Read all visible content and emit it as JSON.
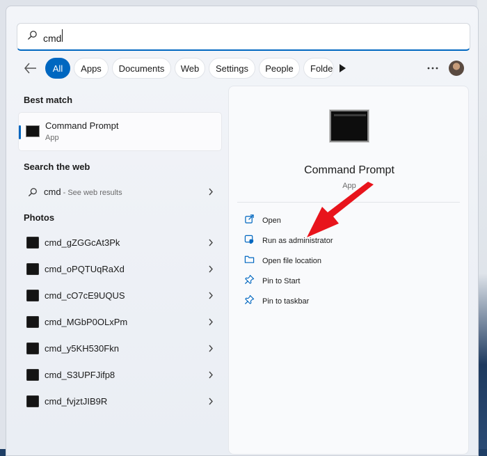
{
  "search": {
    "query": "cmd"
  },
  "filters": [
    {
      "label": "All",
      "active": true
    },
    {
      "label": "Apps"
    },
    {
      "label": "Documents"
    },
    {
      "label": "Web"
    },
    {
      "label": "Settings"
    },
    {
      "label": "People"
    },
    {
      "label": "Folde"
    }
  ],
  "left": {
    "best_match_title": "Best match",
    "best_match": {
      "name": "Command Prompt",
      "type": "App"
    },
    "search_web_title": "Search the web",
    "web_result": {
      "term": "cmd",
      "hint": " - See web results"
    },
    "photos_title": "Photos",
    "photos": [
      "cmd_gZGGcAt3Pk",
      "cmd_oPQTUqRaXd",
      "cmd_cO7cE9UQUS",
      "cmd_MGbP0OLxPm",
      "cmd_y5KH530Fkn",
      "cmd_S3UPFJifp8",
      "cmd_fvjztJIB9R"
    ]
  },
  "details": {
    "title": "Command Prompt",
    "subtitle": "App",
    "actions": [
      {
        "label": "Open",
        "icon": "open-external-icon"
      },
      {
        "label": "Run as administrator",
        "icon": "shield-admin-icon"
      },
      {
        "label": "Open file location",
        "icon": "folder-icon"
      },
      {
        "label": "Pin to Start",
        "icon": "pin-icon"
      },
      {
        "label": "Pin to taskbar",
        "icon": "pin-icon"
      }
    ]
  },
  "colors": {
    "accent": "#0067c0",
    "annotation_arrow": "#e8141c"
  }
}
